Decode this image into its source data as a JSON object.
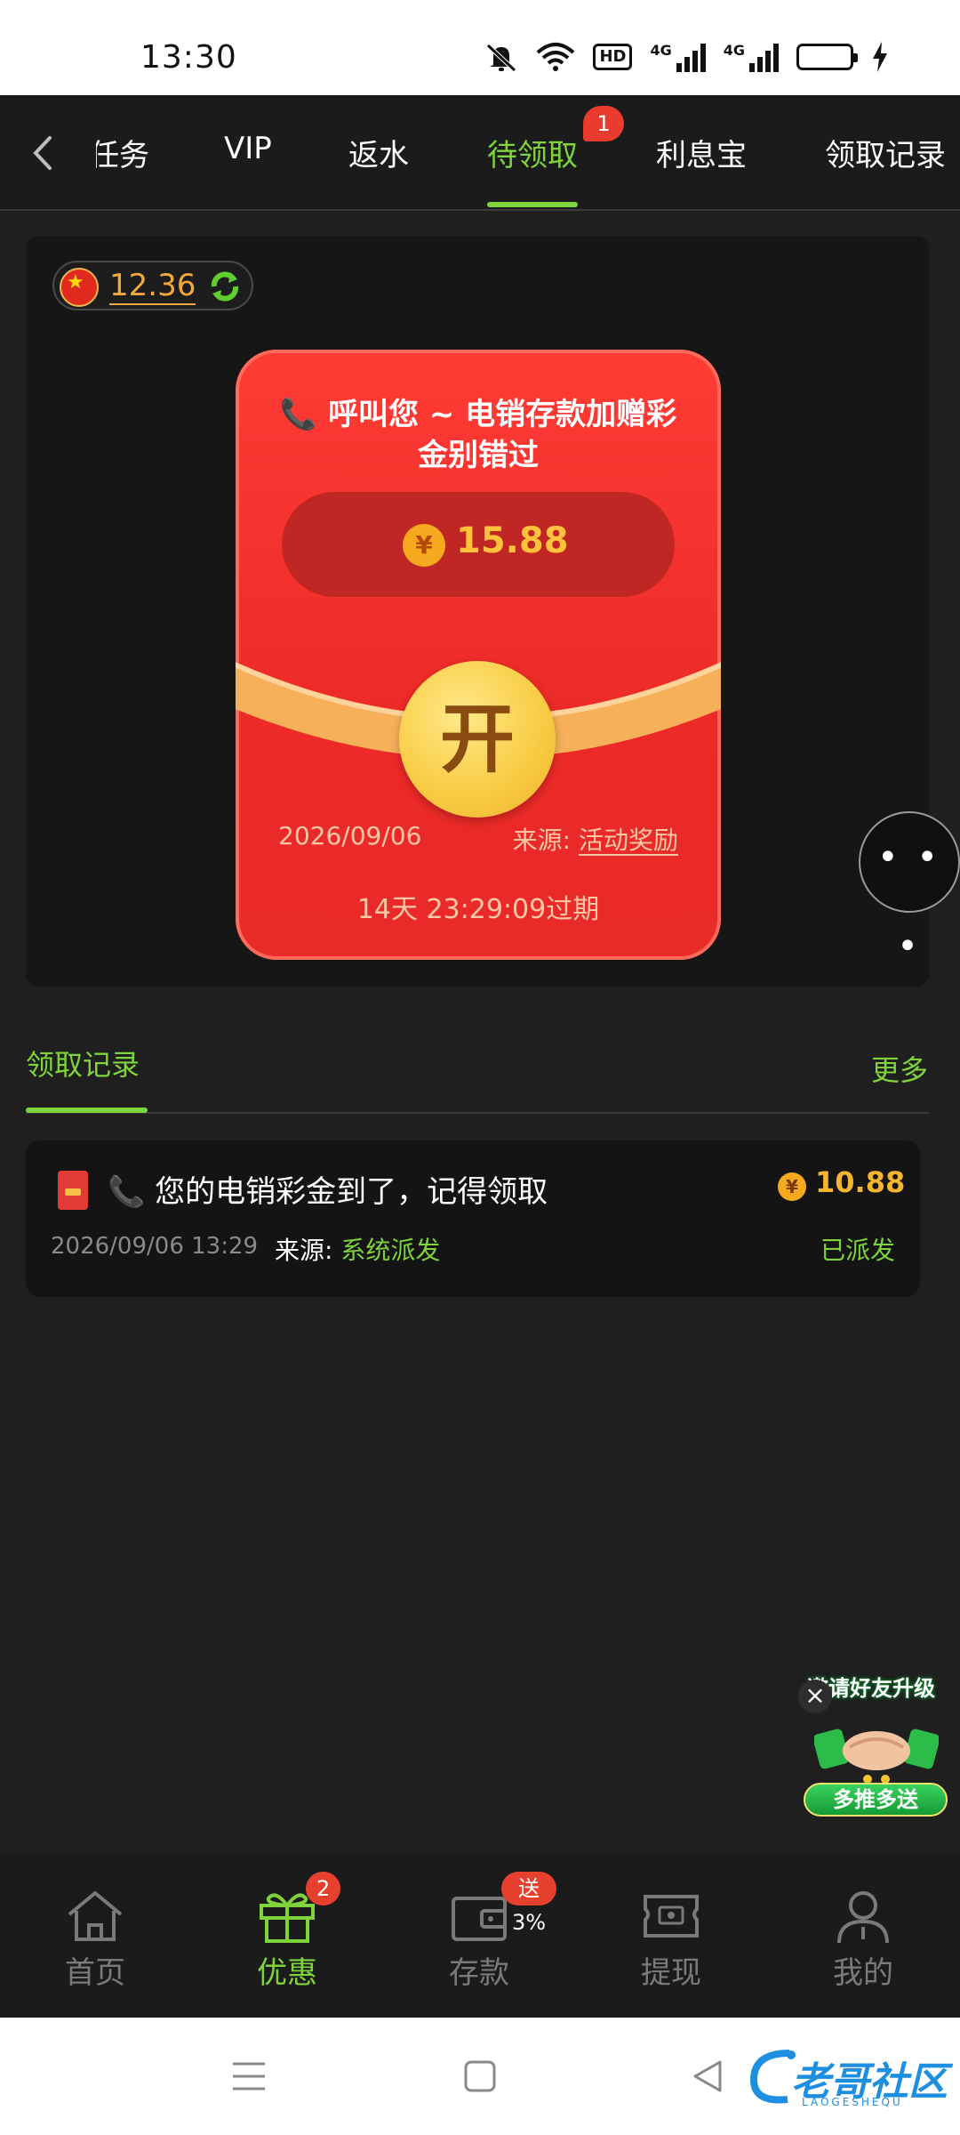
{
  "status_bar": {
    "time": "13:30",
    "icons": [
      "mute-icon",
      "wifi-icon",
      "hd-icon",
      "signal-4g-icon",
      "signal-4g-icon",
      "battery-icon",
      "charging-icon"
    ],
    "hd_label": "HD",
    "network_label": "4G"
  },
  "top_tabs": {
    "items": [
      {
        "label": "任务"
      },
      {
        "label": "VIP"
      },
      {
        "label": "返水"
      },
      {
        "label": "待领取",
        "active": true,
        "badge": "1"
      },
      {
        "label": "利息宝"
      },
      {
        "label": "领取记录"
      }
    ]
  },
  "wallet": {
    "balance": "12.36"
  },
  "envelope": {
    "title": "📞 呼叫您 ~ 电销存款加赠彩金别错过",
    "currency_symbol": "¥",
    "amount": "15.88",
    "open_label": "开",
    "date": "2026/09/06",
    "source_label": "来源:",
    "source_value": "活动奖励",
    "expire_text": "14天 23:29:09过期"
  },
  "records": {
    "header": "领取记录",
    "more": "更多",
    "items": [
      {
        "title": "📞 您的电销彩金到了，记得领取",
        "currency_symbol": "¥",
        "amount": "10.88",
        "time": "2026/09/06 13:29",
        "source_label": "来源:",
        "source_value": "系统派发",
        "status": "已派发"
      }
    ]
  },
  "promo": {
    "title": "邀请好友升级",
    "button": "多推多送"
  },
  "bottom_nav": {
    "items": [
      {
        "label": "首页",
        "icon": "home-icon"
      },
      {
        "label": "优惠",
        "icon": "gift-icon",
        "active": true,
        "badge": "2"
      },
      {
        "label": "存款",
        "icon": "wallet-icon",
        "badge": "送3%"
      },
      {
        "label": "提现",
        "icon": "cash-icon"
      },
      {
        "label": "我的",
        "icon": "user-icon"
      }
    ]
  },
  "watermark": {
    "text": "老哥社区",
    "sub": "LAOGESHEQU"
  },
  "colors": {
    "accent_green": "#7ed43a",
    "envelope_red": "#ec2a27",
    "gold": "#f5b52f",
    "badge_red": "#e7402f",
    "background": "#1f1f1f"
  }
}
